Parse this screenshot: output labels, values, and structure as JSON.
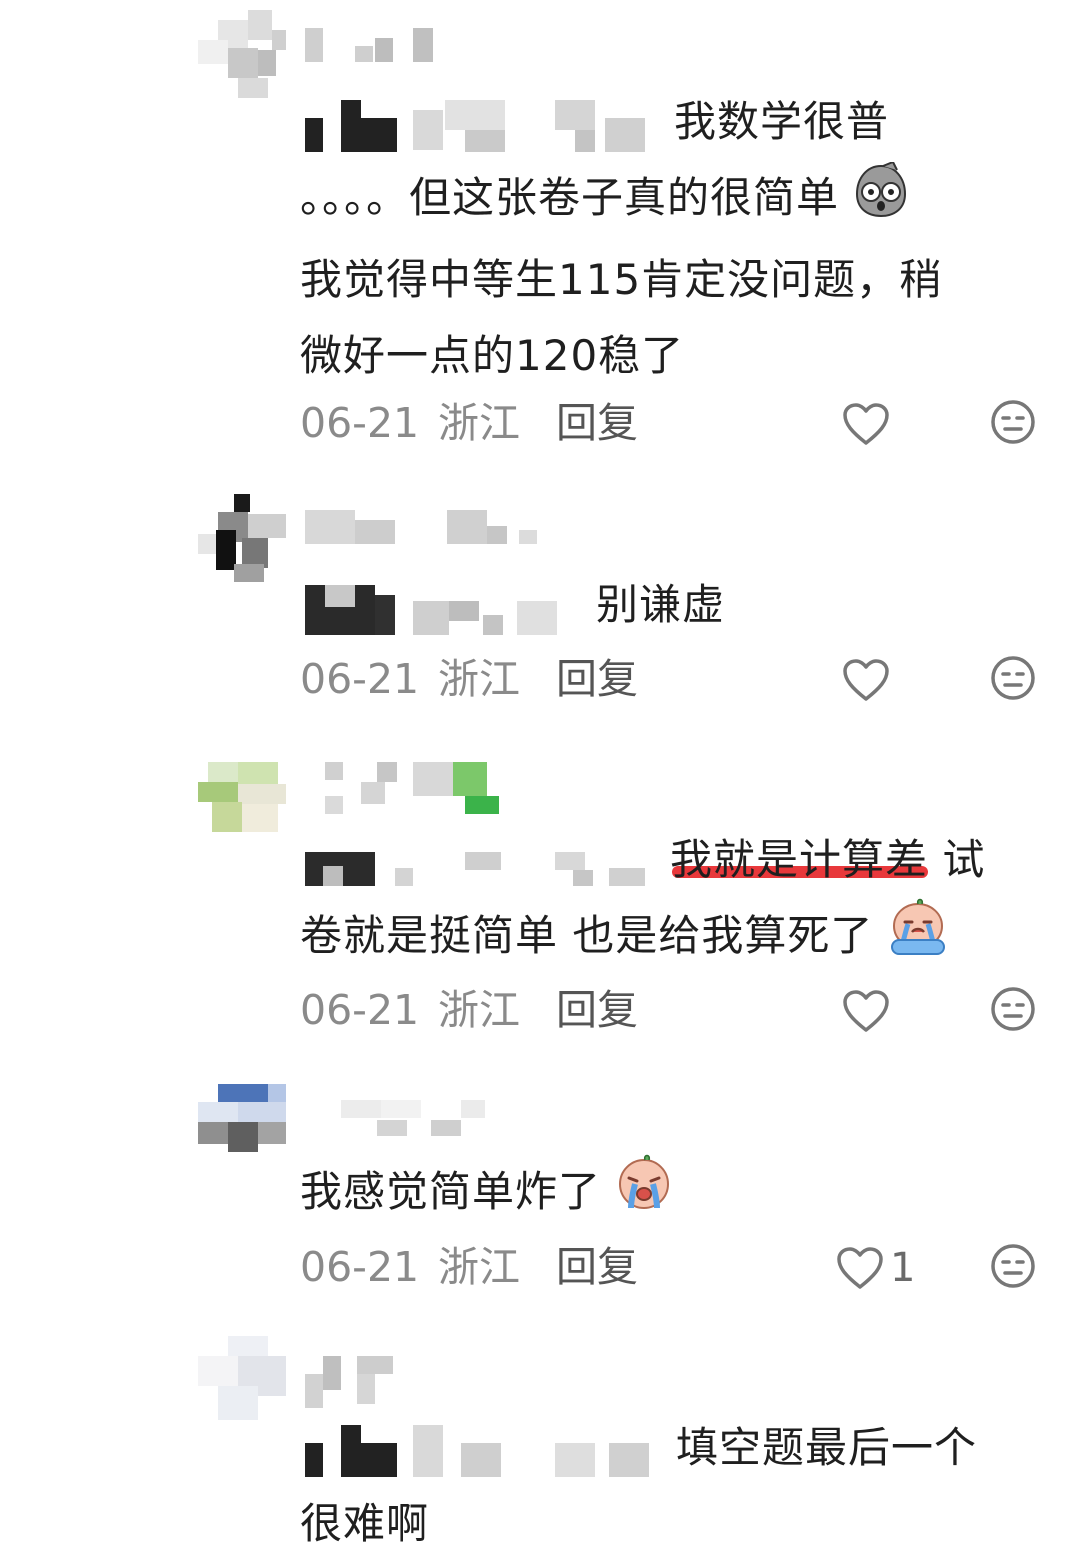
{
  "comments": [
    {
      "lines": [
        "我数学很普",
        "。。。。但这张卷子真的很简单",
        "我觉得中等生115肯定没问题，稍",
        "微好一点的120稳了"
      ],
      "date": "06-21",
      "location": "浙江",
      "reply_label": "回复",
      "likes": ""
    },
    {
      "lines": [
        "别谦虚"
      ],
      "date": "06-21",
      "location": "浙江",
      "reply_label": "回复",
      "likes": ""
    },
    {
      "lines": [
        "我就是计算差 试",
        "卷就是挺简单 也是给我算死了"
      ],
      "date": "06-21",
      "location": "浙江",
      "reply_label": "回复",
      "likes": ""
    },
    {
      "lines": [
        "我感觉简单炸了"
      ],
      "date": "06-21",
      "location": "浙江",
      "reply_label": "回复",
      "likes": "1"
    },
    {
      "lines": [
        "填空题最后一个",
        "很难啊"
      ],
      "date": "",
      "location": "",
      "reply_label": "",
      "likes": ""
    }
  ],
  "icons": {
    "like": "heart-outline-icon",
    "dislike": "neutral-face-icon",
    "emoji_1": "worried-face-emoji",
    "emoji_2": "crying-face-emoji",
    "emoji_3": "crying-face-emoji"
  },
  "colors": {
    "text": "#1f1f1f",
    "meta": "#8a8a8a",
    "highlight": "#e8383b"
  }
}
